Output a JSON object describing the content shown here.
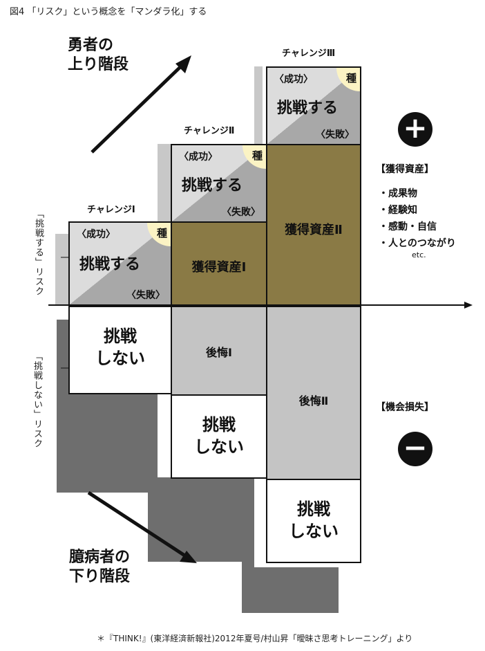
{
  "figure_title": "図4 「リスク」という概念を「マンダラ化」する",
  "hero_label": [
    "勇者の",
    "上り階段"
  ],
  "coward_label": [
    "臆病者の",
    "下り階段"
  ],
  "challenges": [
    {
      "title": "チャレンジⅠ",
      "success": "〈成功〉",
      "action": "挑戦する",
      "failure": "〈失敗〉",
      "seed": "種"
    },
    {
      "title": "チャレンジⅡ",
      "success": "〈成功〉",
      "action": "挑戦する",
      "failure": "〈失敗〉",
      "seed": "種"
    },
    {
      "title": "チャレンジⅢ",
      "success": "〈成功〉",
      "action": "挑戦する",
      "failure": "〈失敗〉",
      "seed": "種"
    }
  ],
  "assets": [
    "獲得資産Ⅰ",
    "獲得資産Ⅱ"
  ],
  "regrets": [
    "後悔Ⅰ",
    "後悔Ⅱ"
  ],
  "no_challenge": [
    "挑戦",
    "しない"
  ],
  "side_left_top": "「挑戦する」リスク",
  "side_left_bottom": "「挑戦しない」リスク",
  "plus": {
    "symbol": "+",
    "heading": "【獲得資産】",
    "items": [
      "・成果物",
      "・経験知",
      "・感動・自信",
      "・人とのつながり"
    ],
    "etc": "etc."
  },
  "minus": {
    "symbol": "−",
    "heading": "【機会損失】"
  },
  "footer": "＊『THINK!』(東洋経済新報社)2012年夏号/村山昇「曖昧さ思考トレーニング」より",
  "colors": {
    "asset": "#8a7a45",
    "regret": "#c4c4c4",
    "shadow_light": "#c8c8c8",
    "shadow_dark": "#6e6e6e",
    "seed": "#fbf3c4"
  }
}
